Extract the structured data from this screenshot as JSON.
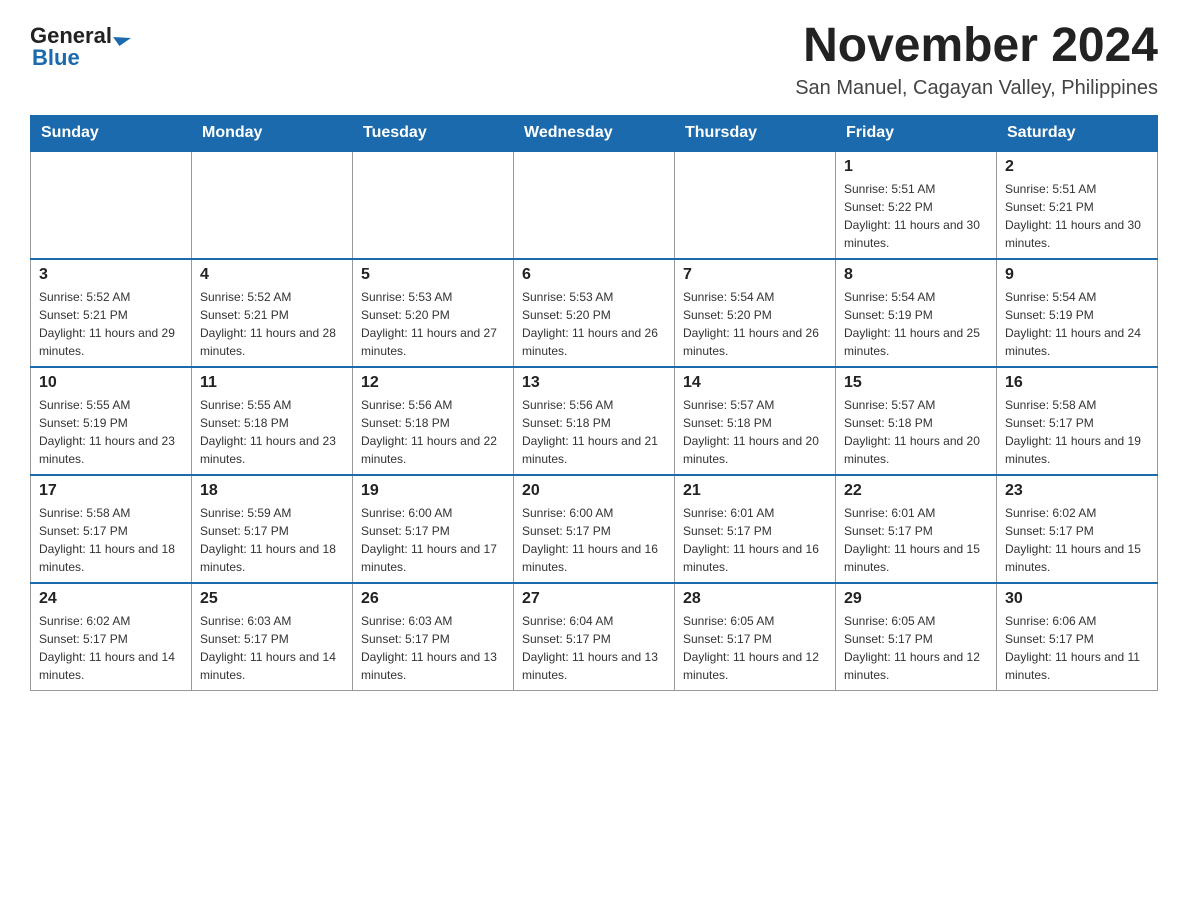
{
  "logo": {
    "general": "General",
    "blue": "Blue",
    "arrow": "▶"
  },
  "title": "November 2024",
  "subtitle": "San Manuel, Cagayan Valley, Philippines",
  "days_of_week": [
    "Sunday",
    "Monday",
    "Tuesday",
    "Wednesday",
    "Thursday",
    "Friday",
    "Saturday"
  ],
  "weeks": [
    [
      {
        "day": "",
        "info": ""
      },
      {
        "day": "",
        "info": ""
      },
      {
        "day": "",
        "info": ""
      },
      {
        "day": "",
        "info": ""
      },
      {
        "day": "",
        "info": ""
      },
      {
        "day": "1",
        "info": "Sunrise: 5:51 AM\nSunset: 5:22 PM\nDaylight: 11 hours and 30 minutes."
      },
      {
        "day": "2",
        "info": "Sunrise: 5:51 AM\nSunset: 5:21 PM\nDaylight: 11 hours and 30 minutes."
      }
    ],
    [
      {
        "day": "3",
        "info": "Sunrise: 5:52 AM\nSunset: 5:21 PM\nDaylight: 11 hours and 29 minutes."
      },
      {
        "day": "4",
        "info": "Sunrise: 5:52 AM\nSunset: 5:21 PM\nDaylight: 11 hours and 28 minutes."
      },
      {
        "day": "5",
        "info": "Sunrise: 5:53 AM\nSunset: 5:20 PM\nDaylight: 11 hours and 27 minutes."
      },
      {
        "day": "6",
        "info": "Sunrise: 5:53 AM\nSunset: 5:20 PM\nDaylight: 11 hours and 26 minutes."
      },
      {
        "day": "7",
        "info": "Sunrise: 5:54 AM\nSunset: 5:20 PM\nDaylight: 11 hours and 26 minutes."
      },
      {
        "day": "8",
        "info": "Sunrise: 5:54 AM\nSunset: 5:19 PM\nDaylight: 11 hours and 25 minutes."
      },
      {
        "day": "9",
        "info": "Sunrise: 5:54 AM\nSunset: 5:19 PM\nDaylight: 11 hours and 24 minutes."
      }
    ],
    [
      {
        "day": "10",
        "info": "Sunrise: 5:55 AM\nSunset: 5:19 PM\nDaylight: 11 hours and 23 minutes."
      },
      {
        "day": "11",
        "info": "Sunrise: 5:55 AM\nSunset: 5:18 PM\nDaylight: 11 hours and 23 minutes."
      },
      {
        "day": "12",
        "info": "Sunrise: 5:56 AM\nSunset: 5:18 PM\nDaylight: 11 hours and 22 minutes."
      },
      {
        "day": "13",
        "info": "Sunrise: 5:56 AM\nSunset: 5:18 PM\nDaylight: 11 hours and 21 minutes."
      },
      {
        "day": "14",
        "info": "Sunrise: 5:57 AM\nSunset: 5:18 PM\nDaylight: 11 hours and 20 minutes."
      },
      {
        "day": "15",
        "info": "Sunrise: 5:57 AM\nSunset: 5:18 PM\nDaylight: 11 hours and 20 minutes."
      },
      {
        "day": "16",
        "info": "Sunrise: 5:58 AM\nSunset: 5:17 PM\nDaylight: 11 hours and 19 minutes."
      }
    ],
    [
      {
        "day": "17",
        "info": "Sunrise: 5:58 AM\nSunset: 5:17 PM\nDaylight: 11 hours and 18 minutes."
      },
      {
        "day": "18",
        "info": "Sunrise: 5:59 AM\nSunset: 5:17 PM\nDaylight: 11 hours and 18 minutes."
      },
      {
        "day": "19",
        "info": "Sunrise: 6:00 AM\nSunset: 5:17 PM\nDaylight: 11 hours and 17 minutes."
      },
      {
        "day": "20",
        "info": "Sunrise: 6:00 AM\nSunset: 5:17 PM\nDaylight: 11 hours and 16 minutes."
      },
      {
        "day": "21",
        "info": "Sunrise: 6:01 AM\nSunset: 5:17 PM\nDaylight: 11 hours and 16 minutes."
      },
      {
        "day": "22",
        "info": "Sunrise: 6:01 AM\nSunset: 5:17 PM\nDaylight: 11 hours and 15 minutes."
      },
      {
        "day": "23",
        "info": "Sunrise: 6:02 AM\nSunset: 5:17 PM\nDaylight: 11 hours and 15 minutes."
      }
    ],
    [
      {
        "day": "24",
        "info": "Sunrise: 6:02 AM\nSunset: 5:17 PM\nDaylight: 11 hours and 14 minutes."
      },
      {
        "day": "25",
        "info": "Sunrise: 6:03 AM\nSunset: 5:17 PM\nDaylight: 11 hours and 14 minutes."
      },
      {
        "day": "26",
        "info": "Sunrise: 6:03 AM\nSunset: 5:17 PM\nDaylight: 11 hours and 13 minutes."
      },
      {
        "day": "27",
        "info": "Sunrise: 6:04 AM\nSunset: 5:17 PM\nDaylight: 11 hours and 13 minutes."
      },
      {
        "day": "28",
        "info": "Sunrise: 6:05 AM\nSunset: 5:17 PM\nDaylight: 11 hours and 12 minutes."
      },
      {
        "day": "29",
        "info": "Sunrise: 6:05 AM\nSunset: 5:17 PM\nDaylight: 11 hours and 12 minutes."
      },
      {
        "day": "30",
        "info": "Sunrise: 6:06 AM\nSunset: 5:17 PM\nDaylight: 11 hours and 11 minutes."
      }
    ]
  ]
}
